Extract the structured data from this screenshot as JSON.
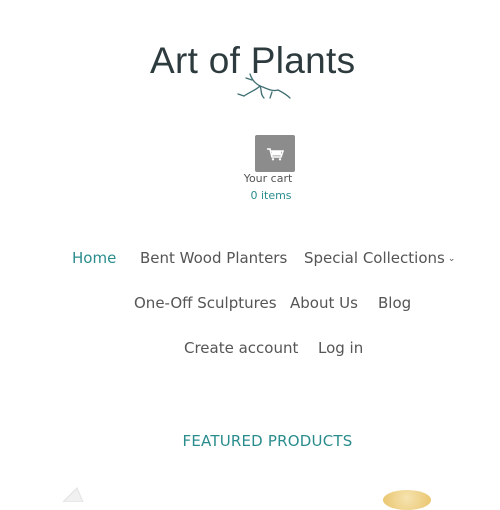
{
  "brand": {
    "name": "Art of Plants"
  },
  "cart": {
    "label": "Your cart",
    "count": "0 items"
  },
  "nav": {
    "home": "Home",
    "bent_wood": "Bent Wood Planters",
    "special": "Special Collections",
    "one_off": "One-Off Sculptures",
    "about": "About Us",
    "blog": "Blog",
    "create_account": "Create account",
    "login": "Log in"
  },
  "featured": {
    "title": "FEATURED PRODUCTS"
  },
  "colors": {
    "accent": "#2a8c8c",
    "text": "#555555",
    "cart_button": "#8c8c8c",
    "logo": "#2e3b3e"
  },
  "icons": {
    "cart": "cart-icon",
    "dropdown": "chevron-down-icon"
  }
}
